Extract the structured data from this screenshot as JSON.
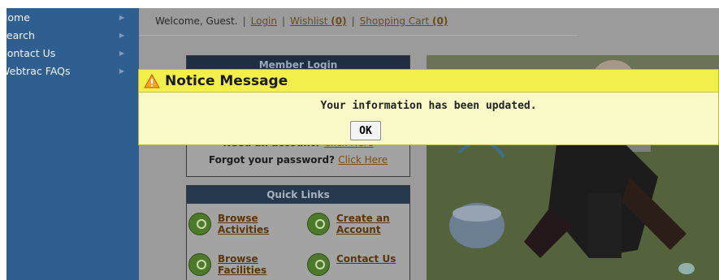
{
  "sidebar": {
    "items": [
      {
        "label": "Home"
      },
      {
        "label": "Search"
      },
      {
        "label": "Contact Us"
      },
      {
        "label": "Webtrac FAQs"
      }
    ]
  },
  "header": {
    "welcome": "Welcome, Guest.",
    "login": "Login",
    "wishlist": "Wishlist",
    "wishlist_count": "(0)",
    "cart": "Shopping Cart",
    "cart_count": "(0)"
  },
  "login_box": {
    "title": "Member Login",
    "need_account": "Need an account?",
    "click_here_1": "Click Here",
    "forgot_password": "Forgot your password?",
    "click_here_2": "Click Here"
  },
  "quick_links": {
    "title": "Quick Links",
    "items": [
      {
        "label": "Browse Activities"
      },
      {
        "label": "Create an Account"
      },
      {
        "label": "Browse Facilities"
      },
      {
        "label": "Contact Us"
      }
    ]
  },
  "notice": {
    "title": "Notice Message",
    "message": "Your information has been updated.",
    "ok": "OK"
  },
  "colors": {
    "sidebar": "#2f5e91",
    "notice_header": "#f3ef4a",
    "notice_body": "#f9f9c8",
    "link": "#6b4a1a"
  }
}
